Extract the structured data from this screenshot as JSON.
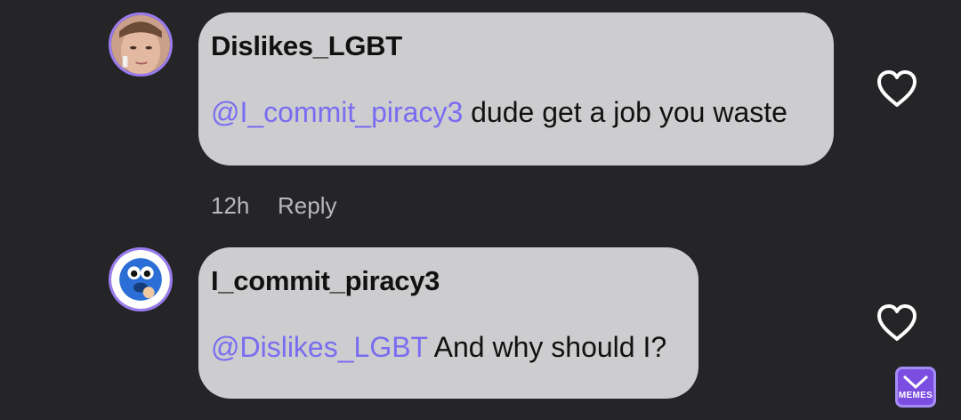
{
  "comments": [
    {
      "username": "Dislikes_LGBT",
      "mention": "@I_commit_piracy3",
      "text": " dude get a job you waste",
      "time": "12h",
      "reply_label": "Reply"
    },
    {
      "username": "I_commit_piracy3",
      "mention": "@Dislikes_LGBT",
      "text": " And why should I?"
    }
  ],
  "watermark": {
    "text": "MEMES"
  },
  "colors": {
    "background": "#252527",
    "bubble": "#cdcdcf",
    "mention": "#7a6cf0",
    "avatar_ring": "#9b7cf0"
  },
  "icons": {
    "like": "heart-outline-icon"
  }
}
